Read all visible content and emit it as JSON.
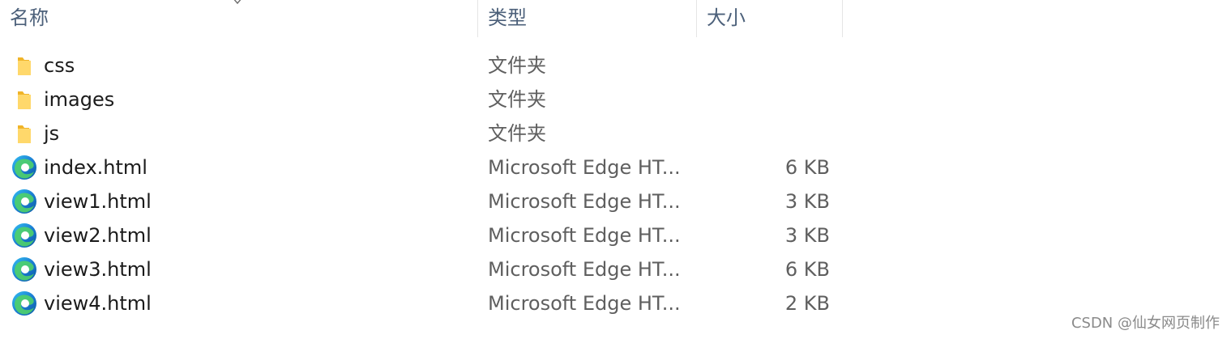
{
  "columns": {
    "name": "名称",
    "type": "类型",
    "size": "大小"
  },
  "files": [
    {
      "name": "css",
      "type": "文件夹",
      "size": "",
      "icon": "folder-icon"
    },
    {
      "name": "images",
      "type": "文件夹",
      "size": "",
      "icon": "folder-icon"
    },
    {
      "name": "js",
      "type": "文件夹",
      "size": "",
      "icon": "folder-icon"
    },
    {
      "name": "index.html",
      "type": "Microsoft Edge HT...",
      "size": "6 KB",
      "icon": "edge-html-icon"
    },
    {
      "name": "view1.html",
      "type": "Microsoft Edge HT...",
      "size": "3 KB",
      "icon": "edge-html-icon"
    },
    {
      "name": "view2.html",
      "type": "Microsoft Edge HT...",
      "size": "3 KB",
      "icon": "edge-html-icon"
    },
    {
      "name": "view3.html",
      "type": "Microsoft Edge HT...",
      "size": "6 KB",
      "icon": "edge-html-icon"
    },
    {
      "name": "view4.html",
      "type": "Microsoft Edge HT...",
      "size": "2 KB",
      "icon": "edge-html-icon"
    }
  ],
  "watermark": "CSDN @仙女网页制作",
  "colors": {
    "header_text": "#4c607a",
    "folder": "#f5c74f",
    "edge_blue": "#0c59a4",
    "edge_green": "#4fd16a"
  }
}
